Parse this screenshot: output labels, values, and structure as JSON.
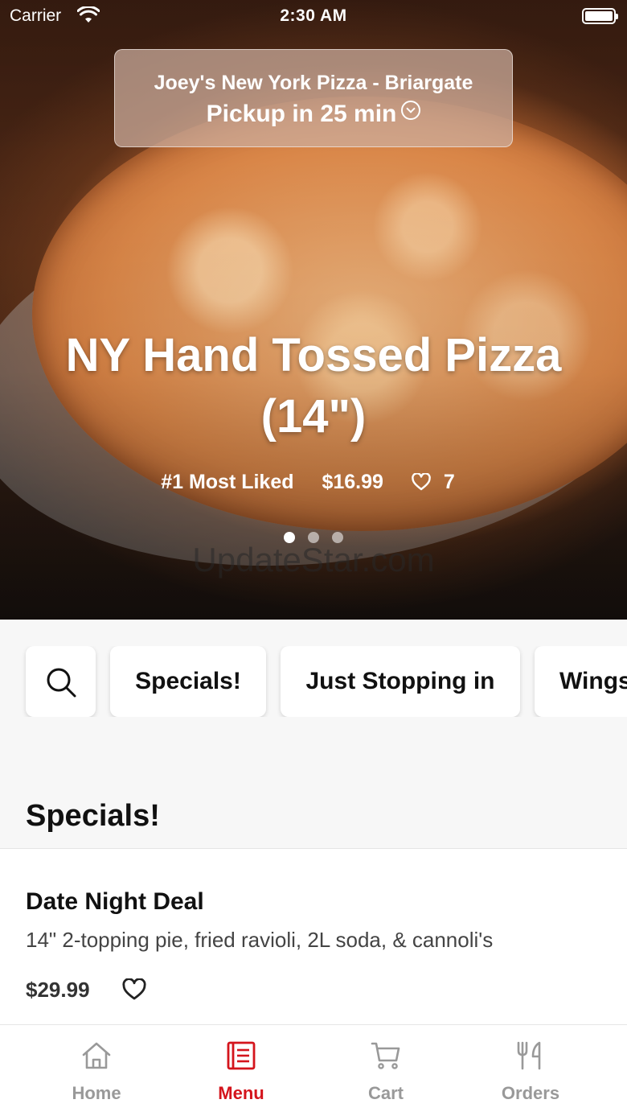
{
  "status_bar": {
    "carrier": "Carrier",
    "time": "2:30 AM"
  },
  "location": {
    "name": "Joey's New York Pizza - Briargate",
    "pickup": "Pickup in 25 min"
  },
  "hero": {
    "title": "NY Hand Tossed Pizza (14\")",
    "rank": "#1 Most Liked",
    "price": "$16.99",
    "likes": "7",
    "slide_count": 3,
    "active_slide": 1,
    "watermark": "UpdateStar.com"
  },
  "categories": [
    "Specials!",
    "Just Stopping in",
    "Wings"
  ],
  "section": {
    "title": "Specials!"
  },
  "items": [
    {
      "title": "Date Night Deal",
      "description": "14\" 2-topping pie, fried ravioli, 2L soda, & cannoli's",
      "price": "$29.99"
    }
  ],
  "tabs": [
    {
      "label": "Home",
      "icon": "home-icon"
    },
    {
      "label": "Menu",
      "icon": "menu-icon",
      "active": true
    },
    {
      "label": "Cart",
      "icon": "cart-icon"
    },
    {
      "label": "Orders",
      "icon": "utensils-icon"
    }
  ],
  "colors": {
    "accent": "#d4141c",
    "inactive_tab": "#999999",
    "background": "#f7f7f7"
  }
}
